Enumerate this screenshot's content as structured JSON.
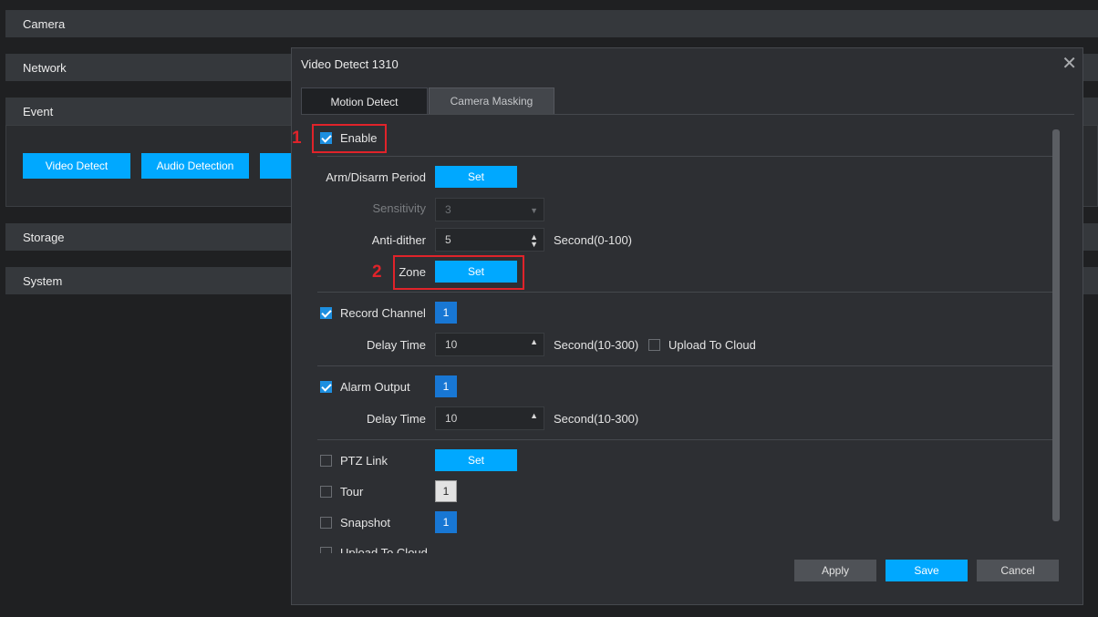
{
  "background": {
    "sections": {
      "camera": "Camera",
      "network": "Network",
      "event": "Event",
      "storage": "Storage",
      "system": "System"
    },
    "event_buttons": {
      "video_detect": "Video Detect",
      "audio_detection": "Audio Detection"
    }
  },
  "dialog": {
    "title": "Video Detect 1310",
    "close_icon": "close-icon",
    "tabs": {
      "motion_detect": "Motion Detect",
      "camera_masking": "Camera Masking"
    },
    "enable": {
      "label": "Enable",
      "checked": true
    },
    "arm_disarm": {
      "label": "Arm/Disarm Period",
      "button": "Set"
    },
    "sensitivity": {
      "label": "Sensitivity",
      "value": "3"
    },
    "anti_dither": {
      "label": "Anti-dither",
      "value": "5",
      "unit": "Second(0-100)"
    },
    "zone": {
      "label": "Zone",
      "button": "Set"
    },
    "record_channel": {
      "label": "Record Channel",
      "checked": true,
      "channel": "1"
    },
    "record_delay": {
      "label": "Delay Time",
      "value": "10",
      "unit": "Second(10-300)"
    },
    "upload_to_cloud": {
      "label": "Upload To Cloud",
      "checked": false
    },
    "alarm_output": {
      "label": "Alarm Output",
      "checked": true,
      "channel": "1"
    },
    "alarm_delay": {
      "label": "Delay Time",
      "value": "10",
      "unit": "Second(10-300)"
    },
    "ptz_link": {
      "label": "PTZ Link",
      "checked": false,
      "button": "Set"
    },
    "tour": {
      "label": "Tour",
      "checked": false,
      "channel": "1"
    },
    "snapshot": {
      "label": "Snapshot",
      "checked": false,
      "channel": "1"
    },
    "upload_to_cloud_2": {
      "label": "Upload To Cloud"
    },
    "footer": {
      "apply": "Apply",
      "save": "Save",
      "cancel": "Cancel"
    }
  },
  "annotations": {
    "one": "1",
    "two": "2"
  },
  "colors": {
    "accent": "#00a8ff",
    "channel": "#1877d4",
    "highlight": "#e0232a"
  }
}
